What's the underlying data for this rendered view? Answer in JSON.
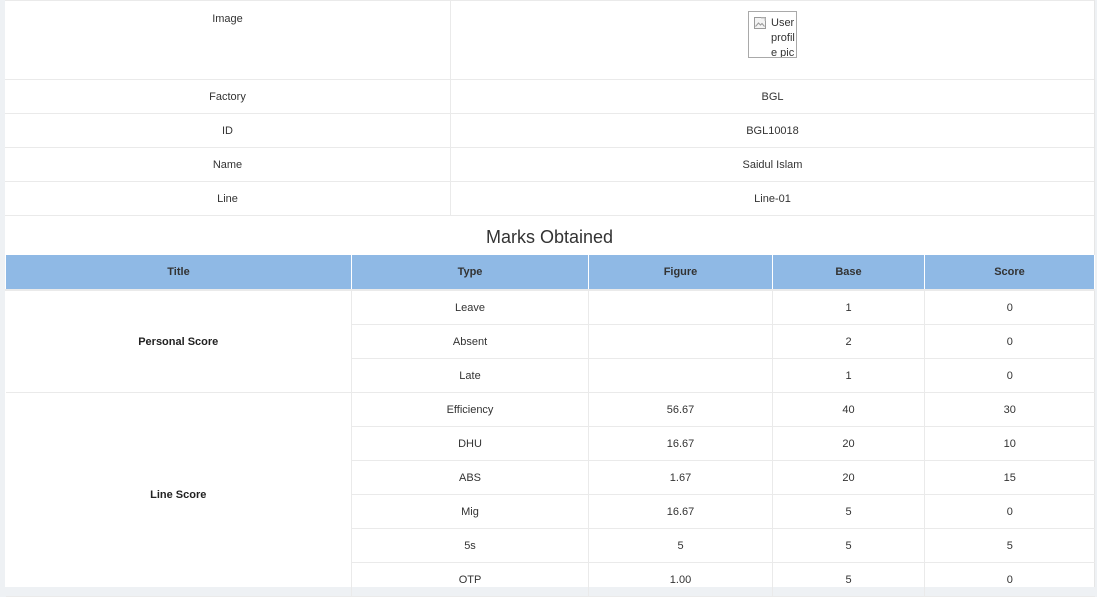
{
  "profile": {
    "image_label": "Image",
    "image_alt": "User profile picture",
    "rows": [
      {
        "label": "Factory",
        "value": "BGL"
      },
      {
        "label": "ID",
        "value": "BGL10018"
      },
      {
        "label": "Name",
        "value": "Saidul Islam"
      },
      {
        "label": "Line",
        "value": "Line-01"
      }
    ]
  },
  "marks": {
    "title": "Marks Obtained",
    "headers": [
      "Title",
      "Type",
      "Figure",
      "Base",
      "Score"
    ],
    "groups": [
      {
        "title": "Personal Score",
        "rows": [
          {
            "type": "Leave",
            "figure": "",
            "base": "1",
            "score": "0"
          },
          {
            "type": "Absent",
            "figure": "",
            "base": "2",
            "score": "0"
          },
          {
            "type": "Late",
            "figure": "",
            "base": "1",
            "score": "0"
          }
        ]
      },
      {
        "title": "Line Score",
        "rows": [
          {
            "type": "Efficiency",
            "figure": "56.67",
            "base": "40",
            "score": "30"
          },
          {
            "type": "DHU",
            "figure": "16.67",
            "base": "20",
            "score": "10"
          },
          {
            "type": "ABS",
            "figure": "1.67",
            "base": "20",
            "score": "15"
          },
          {
            "type": "Mig",
            "figure": "16.67",
            "base": "5",
            "score": "0"
          },
          {
            "type": "5s",
            "figure": "5",
            "base": "5",
            "score": "5"
          },
          {
            "type": "OTP",
            "figure": "1.00",
            "base": "5",
            "score": "0"
          }
        ]
      }
    ]
  }
}
